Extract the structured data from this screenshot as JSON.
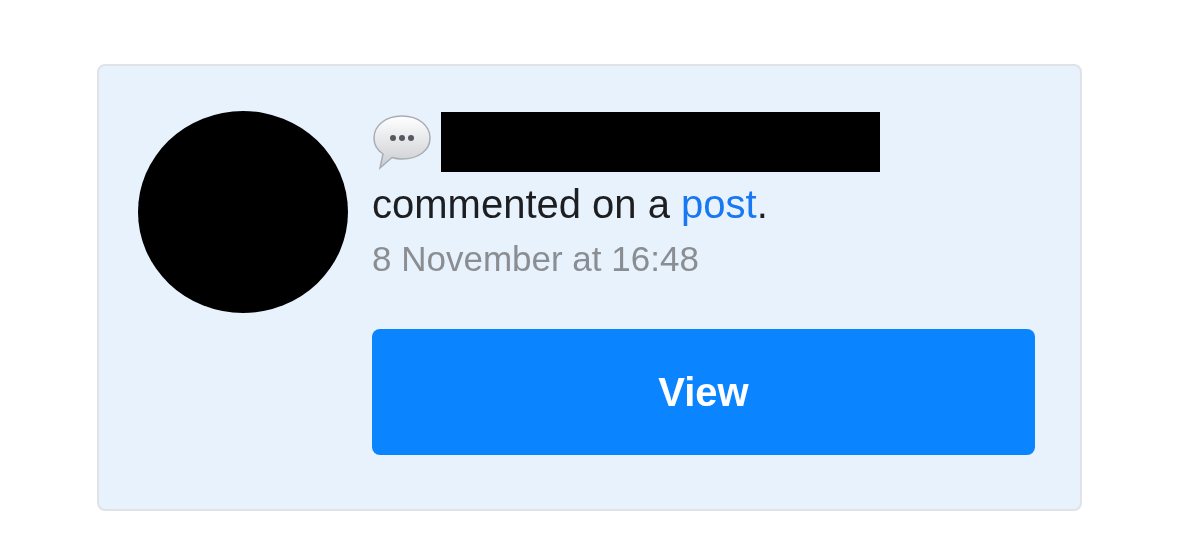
{
  "notification": {
    "text_before": "commented on a ",
    "link": "post",
    "text_after": ".",
    "time": "8 November at 16:48"
  },
  "button": {
    "label": "View"
  }
}
